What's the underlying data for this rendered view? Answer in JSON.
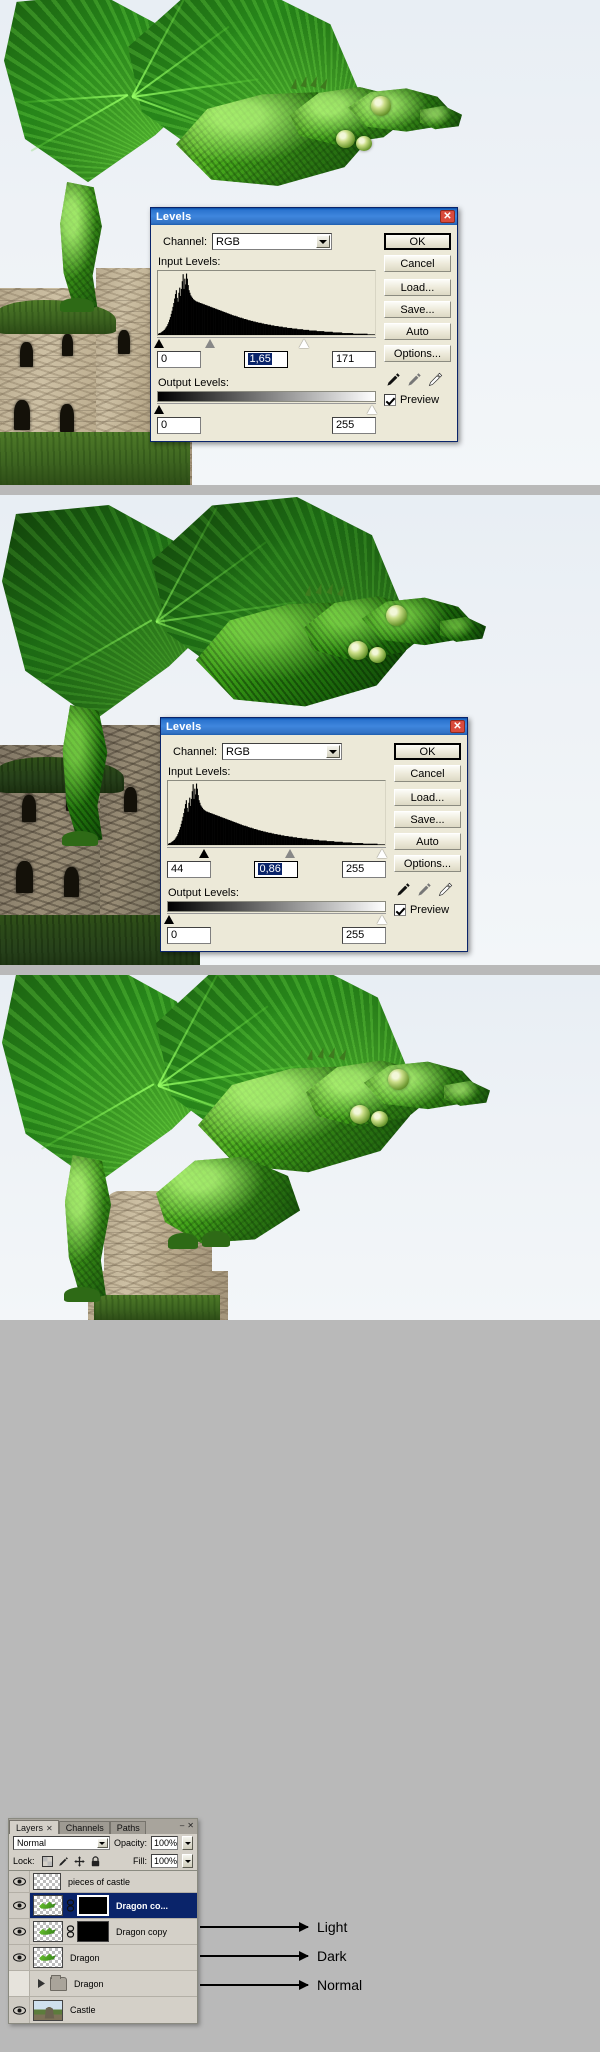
{
  "panels": [
    {
      "name": "light-version",
      "caption": ""
    },
    {
      "name": "dark-version",
      "caption": ""
    },
    {
      "name": "normal-version",
      "caption": ""
    }
  ],
  "levels_dialog_1": {
    "title": "Levels",
    "close_label": "✕",
    "channel_label": "Channel:",
    "channel_value": "RGB",
    "input_levels_label": "Input Levels:",
    "output_levels_label": "Output Levels:",
    "input_black": "0",
    "input_gamma": "1,65",
    "input_white": "171",
    "output_black": "0",
    "output_white": "255",
    "knob_black_pct": 1,
    "knob_gamma_pct": 24,
    "knob_white_pct": 67,
    "out_black_pct": 1,
    "out_white_pct": 98,
    "buttons": [
      "OK",
      "Cancel",
      "Load...",
      "Save...",
      "Auto",
      "Options..."
    ],
    "preview_label": "Preview",
    "preview_checked": true,
    "eyedropper_names": [
      "black-point-eyedropper",
      "gray-point-eyedropper",
      "white-point-eyedropper"
    ]
  },
  "levels_dialog_2": {
    "title": "Levels",
    "close_label": "✕",
    "channel_label": "Channel:",
    "channel_value": "RGB",
    "input_levels_label": "Input Levels:",
    "output_levels_label": "Output Levels:",
    "input_black": "44",
    "input_gamma": "0,86",
    "input_white": "255",
    "output_black": "0",
    "output_white": "255",
    "knob_black_pct": 17,
    "knob_gamma_pct": 56,
    "knob_white_pct": 98,
    "out_black_pct": 1,
    "out_white_pct": 98,
    "buttons": [
      "OK",
      "Cancel",
      "Load...",
      "Save...",
      "Auto",
      "Options..."
    ],
    "preview_label": "Preview",
    "preview_checked": true,
    "eyedropper_names": [
      "black-point-eyedropper",
      "gray-point-eyedropper",
      "white-point-eyedropper"
    ]
  },
  "histogram": {
    "bins": [
      2,
      3,
      3,
      4,
      5,
      6,
      7,
      8,
      10,
      12,
      14,
      17,
      20,
      24,
      28,
      33,
      38,
      44,
      50,
      57,
      64,
      70,
      58,
      52,
      66,
      74,
      61,
      72,
      84,
      95,
      72,
      88,
      79,
      96,
      88,
      78,
      70,
      66,
      62,
      60,
      58,
      56,
      55,
      54,
      53,
      52,
      52,
      51,
      51,
      50,
      50,
      49,
      49,
      48,
      48,
      47,
      47,
      46,
      46,
      45,
      45,
      44,
      44,
      43,
      43,
      42,
      42,
      41,
      41,
      40,
      40,
      39,
      39,
      38,
      38,
      37,
      37,
      36,
      36,
      35,
      35,
      34,
      34,
      33,
      33,
      32,
      32,
      31,
      31,
      30,
      30,
      30,
      29,
      29,
      28,
      28,
      27,
      27,
      27,
      26,
      26,
      25,
      25,
      25,
      24,
      24,
      23,
      23,
      23,
      22,
      22,
      22,
      21,
      21,
      21,
      20,
      20,
      20,
      19,
      19,
      19,
      19,
      18,
      18,
      18,
      17,
      17,
      17,
      17,
      16,
      16,
      16,
      16,
      15,
      15,
      15,
      15,
      14,
      14,
      14,
      14,
      14,
      13,
      13,
      13,
      13,
      13,
      12,
      12,
      12,
      12,
      12,
      11,
      11,
      11,
      11,
      11,
      11,
      10,
      10,
      10,
      10,
      10,
      10,
      9,
      9,
      9,
      9,
      9,
      9,
      9,
      8,
      8,
      8,
      8,
      8,
      8,
      8,
      7,
      7,
      7,
      7,
      7,
      7,
      7,
      7,
      7,
      6,
      6,
      6,
      6,
      6,
      6,
      6,
      6,
      6,
      5,
      5,
      5,
      5,
      5,
      5,
      5,
      5,
      5,
      5,
      4,
      4,
      4,
      4,
      4,
      4,
      4,
      4,
      4,
      4,
      4,
      3,
      3,
      3,
      3,
      3,
      3,
      3,
      3,
      3,
      3,
      3,
      3,
      3,
      2,
      2,
      2,
      2,
      2,
      2,
      2,
      2,
      2,
      2,
      2,
      2,
      2,
      2,
      2,
      2,
      2,
      1,
      1,
      1,
      1,
      1,
      1,
      1,
      1,
      1
    ],
    "max": 96
  },
  "layers_panel": {
    "tabs": [
      {
        "label": "Layers",
        "active": true,
        "close": "✕"
      },
      {
        "label": "Channels",
        "active": false,
        "close": ""
      },
      {
        "label": "Paths",
        "active": false,
        "close": ""
      }
    ],
    "window_buttons": [
      "–",
      "✕"
    ],
    "blend_mode": "Normal",
    "opacity_label": "Opacity:",
    "opacity_value": "100%",
    "lock_label": "Lock:",
    "lock_icons": [
      "lock-transparency-icon",
      "lock-image-icon",
      "lock-position-icon",
      "lock-all-icon"
    ],
    "fill_label": "Fill:",
    "fill_value": "100%",
    "layers": [
      {
        "name": "pieces of castle",
        "visible": true,
        "selected": false,
        "type": "pixel",
        "has_mask": false,
        "linked": false,
        "partial": true
      },
      {
        "name": "Dragon co...",
        "visible": true,
        "selected": true,
        "type": "pixel",
        "has_mask": true,
        "linked": true
      },
      {
        "name": "Dragon copy",
        "visible": true,
        "selected": false,
        "type": "pixel",
        "has_mask": true,
        "linked": true
      },
      {
        "name": "Dragon",
        "visible": true,
        "selected": false,
        "type": "pixel",
        "has_mask": false,
        "linked": false
      },
      {
        "name": "Dragon",
        "visible": false,
        "selected": false,
        "type": "group",
        "has_mask": false,
        "linked": false
      },
      {
        "name": "Castle",
        "visible": true,
        "selected": false,
        "type": "castle",
        "has_mask": false,
        "linked": false
      }
    ]
  },
  "annotations": [
    {
      "label": "Light",
      "target_layer": "Dragon co..."
    },
    {
      "label": "Dark",
      "target_layer": "Dragon copy"
    },
    {
      "label": "Normal",
      "target_layer": "Dragon"
    }
  ],
  "colors": {
    "titlebar_blue": "#3f86dd",
    "dialog_face": "#ece9d8",
    "selection_blue": "#0a246a",
    "page_background": "#b9b9b9",
    "dragon_green": "#46a81c"
  }
}
